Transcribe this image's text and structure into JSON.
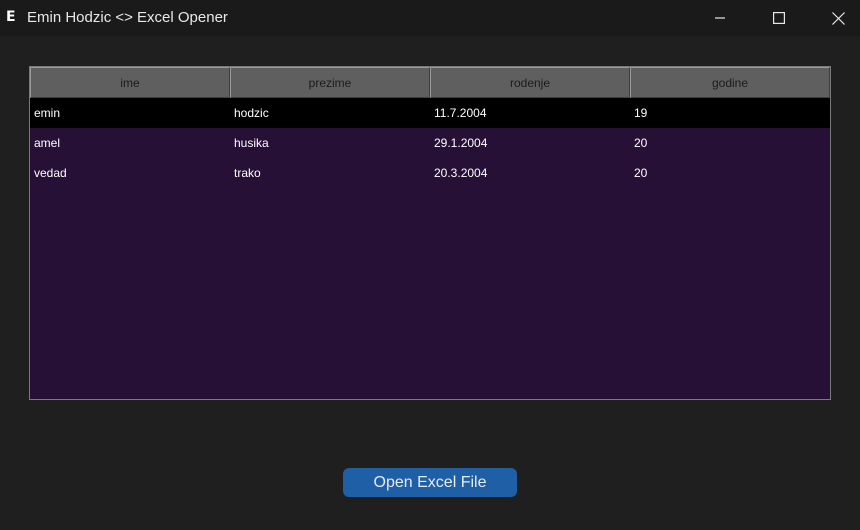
{
  "window": {
    "title": "Emin Hodzic <> Excel Opener",
    "app_icon_glyph": "E",
    "icons": [
      "minimize-icon",
      "maximize-icon",
      "close-icon"
    ]
  },
  "table": {
    "columns": [
      "ime",
      "prezime",
      "rodenje",
      "godine"
    ],
    "rows": [
      [
        "emin",
        "hodzic",
        "11.7.2004",
        "19"
      ],
      [
        "amel",
        "husika",
        "29.1.2004",
        "20"
      ],
      [
        "vedad",
        "trako",
        "20.3.2004",
        "20"
      ]
    ],
    "selected_row": 0
  },
  "actions": {
    "open_label": "Open Excel File"
  },
  "colors": {
    "background": "#1f1f1f",
    "table_background": "#261036",
    "header_background": "#5f5f5f",
    "selected_row": "#000000",
    "button": "#1f5fa6"
  }
}
